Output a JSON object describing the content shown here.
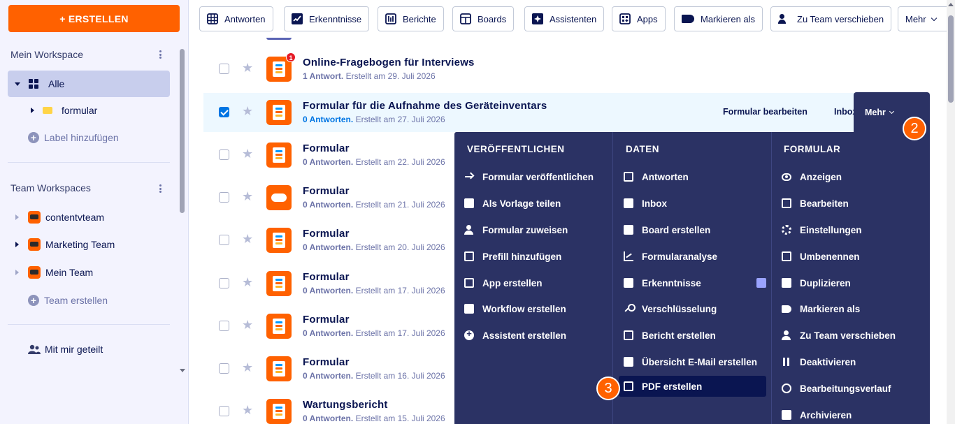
{
  "sidebar": {
    "create_label": "+ ERSTELLEN",
    "my_workspace": "Mein Workspace",
    "all_label": "Alle",
    "folder_label": "formular",
    "add_label": "Label hinzufügen",
    "team_workspaces": "Team Workspaces",
    "teams": [
      "contentvteam",
      "Marketing Team",
      "Mein Team"
    ],
    "create_team": "Team erstellen",
    "shared": "Mit mir geteilt"
  },
  "toolbar": {
    "items": [
      "Antworten",
      "Erkenntnisse",
      "Berichte",
      "Boards",
      "Assistenten",
      "Apps",
      "Markieren als",
      "Zu Team verschieben",
      "Mehr"
    ]
  },
  "forms": [
    {
      "title": "Online-Fragebogen für Interviews",
      "count": "1 Antwort.",
      "created": "Erstellt am 29. Juli 2026",
      "badge": "1"
    },
    {
      "title": "Formular für die Aufnahme des Geräteinventars",
      "count": "0 Antworten.",
      "created": "Erstellt am 27. Juli 2026"
    },
    {
      "title": "Formular",
      "count": "0 Antworten.",
      "created": "Erstellt am 22. Juli 2026"
    },
    {
      "title": "Formular",
      "count": "0 Antworten.",
      "created": "Erstellt am 21. Juli 2026"
    },
    {
      "title": "Formular",
      "count": "0 Antworten.",
      "created": "Erstellt am 20. Juli 2026"
    },
    {
      "title": "Formular",
      "count": "0 Antworten.",
      "created": "Erstellt am 17. Juli 2026"
    },
    {
      "title": "Formular",
      "count": "0 Antworten.",
      "created": "Erstellt am 17. Juli 2026"
    },
    {
      "title": "Formular",
      "count": "0 Antworten.",
      "created": "Erstellt am 16. Juli 2026"
    },
    {
      "title": "Wartungsbericht",
      "count": "0 Antworten.",
      "created": "Erstellt am 15. Juli 2026"
    }
  ],
  "row_actions": {
    "edit": "Formular bearbeiten",
    "inbox": "Inbox",
    "more": "Mehr"
  },
  "menu": {
    "publish_head": "VERÖFFENTLICHEN",
    "publish": [
      "Formular veröffentlichen",
      "Als Vorlage teilen",
      "Formular zuweisen",
      "Prefill hinzufügen",
      "App erstellen",
      "Workflow erstellen",
      "Assistent erstellen"
    ],
    "data_head": "DATEN",
    "data": [
      "Antworten",
      "Inbox",
      "Board erstellen",
      "Formularanalyse",
      "Erkenntnisse",
      "Verschlüsselung",
      "Bericht erstellen",
      "Übersicht E-Mail erstellen",
      "PDF erstellen"
    ],
    "form_head": "FORMULAR",
    "form": [
      "Anzeigen",
      "Bearbeiten",
      "Einstellungen",
      "Umbenennen",
      "Duplizieren",
      "Markieren als",
      "Zu Team verschieben",
      "Deaktivieren",
      "Bearbeitungsverlauf",
      "Archivieren"
    ]
  },
  "steps": [
    "2",
    "3"
  ],
  "colors": {
    "accent": "#ff6100",
    "menu_bg": "#2b3264",
    "link": "#0075e3"
  }
}
